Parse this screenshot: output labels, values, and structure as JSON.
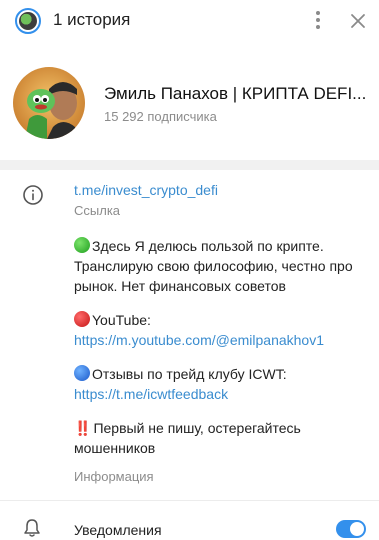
{
  "header": {
    "title": "1 история"
  },
  "profile": {
    "name": "Эмиль Панахов | КРИПТА DEFI...",
    "subscribers": "15 292 подписчика"
  },
  "info": {
    "link": "t.me/invest_crypto_defi",
    "link_caption": "Ссылка",
    "description": [
      {
        "emoji": "green-circle",
        "text": "Здесь Я делюсь пользой по крипте. Транслирую свою философию, честно про рынок. Нет финансовых советов"
      },
      {
        "emoji": "red-circle",
        "text": "YouTube:",
        "link": "https://m.youtube.com/@emilpanakhov1"
      },
      {
        "emoji": "blue-circle",
        "text": "Отзывы по трейд клубу ICWT:",
        "link": "https://t.me/icwtfeedback"
      },
      {
        "emoji": "double-exclamation",
        "emoji_text": "‼️",
        "text": "Первый не пишу, остерегайтесь мошенников"
      }
    ],
    "description_caption": "Информация"
  },
  "notifications": {
    "label": "Уведомления",
    "enabled": true
  },
  "colors": {
    "accent": "#3390ec",
    "link": "#3a8ccf",
    "muted": "#8c8c8c"
  }
}
